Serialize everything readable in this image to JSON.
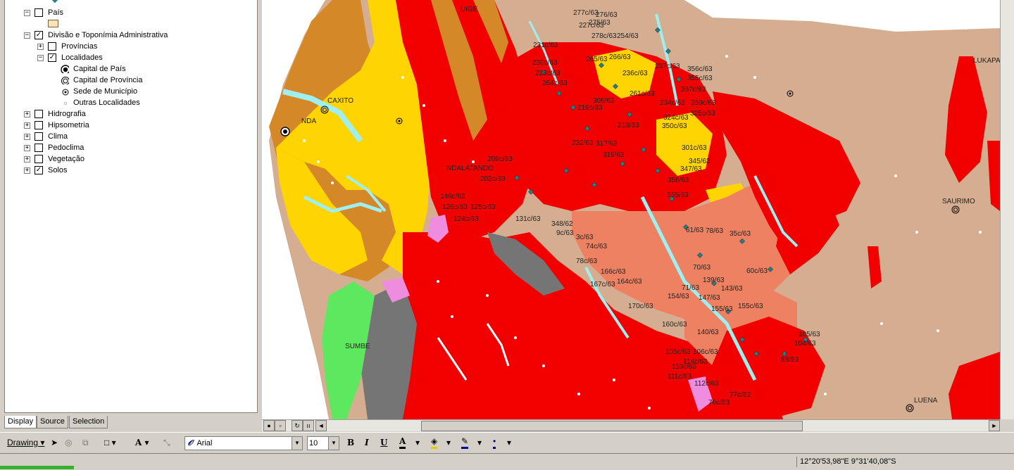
{
  "toc": {
    "layers": [
      {
        "label": "País",
        "expander": "−",
        "checked": false
      },
      {
        "label": "Divisão e Toponímia Administrativa",
        "expander": "−",
        "checked": true
      },
      {
        "label": "Províncias",
        "expander": "+",
        "checked": false
      },
      {
        "label": "Localidades",
        "expander": "−",
        "checked": true
      },
      {
        "label": "Hidrografia",
        "expander": "+",
        "checked": false
      },
      {
        "label": "Hipsometria",
        "expander": "+",
        "checked": false
      },
      {
        "label": "Clima",
        "expander": "+",
        "checked": false
      },
      {
        "label": "Pedoclima",
        "expander": "+",
        "checked": false
      },
      {
        "label": "Vegetação",
        "expander": "+",
        "checked": false
      },
      {
        "label": "Solos",
        "expander": "+",
        "checked": true
      }
    ],
    "legend": [
      {
        "label": "Capital de País",
        "icon": "capital-country-icon"
      },
      {
        "label": "Capital de Província",
        "icon": "capital-province-icon"
      },
      {
        "label": "Sede de Município",
        "icon": "municipality-seat-icon"
      },
      {
        "label": "Outras Localidades",
        "icon": "other-locality-icon"
      }
    ],
    "country_swatch_color": "#f7e3b5",
    "tabs": [
      "Display",
      "Source",
      "Selection"
    ],
    "active_tab": "Display"
  },
  "map": {
    "colors": {
      "background": "#d5ae92",
      "red": "#f20000",
      "yellow": "#ffd400",
      "orange": "#d48827",
      "salmon": "#ef8163",
      "cyan": "#9feef0",
      "green": "#5de85f",
      "gray": "#757575",
      "pink": "#f08ce0",
      "point": "#2a7d84"
    },
    "place_labels": [
      "UIGE",
      "CAXITO",
      "NDA",
      "NDALATANDO",
      "SUMBE",
      "LUENA",
      "SAURIMO",
      "LUKAPA"
    ],
    "parcel_labels": [
      "277c/63",
      "276/63",
      "275/63",
      "227c/63",
      "278c/63",
      "254/63",
      "231c/63",
      "230c/63",
      "265/63",
      "266/63",
      "228c/63",
      "264c/63",
      "236c/63",
      "237c/63",
      "261c/63",
      "219c/63",
      "306/63",
      "218/63",
      "232/63",
      "317/63",
      "319/63",
      "209c/63",
      "202c/63",
      "146c/63",
      "126c/63",
      "125c/63",
      "124c/63",
      "131c/63",
      "348/62",
      "9c/63",
      "3c/63",
      "74c/63",
      "78c/63",
      "166c/63",
      "167c/63",
      "164c/63",
      "170c/63",
      "154/63",
      "160c/63",
      "140/63",
      "105c/63",
      "106c/63",
      "114c/63",
      "110c/63",
      "111c/63",
      "112c/63",
      "76c/63",
      "77c/62",
      "88/63",
      "105/63",
      "104/63",
      "358/63",
      "365/63",
      "345/63",
      "347/63",
      "301c/63",
      "357c/63",
      "359c/63",
      "325c/63",
      "294c/63",
      "324c/63",
      "350c/63",
      "355c/63",
      "356c/63",
      "61/63",
      "78/63",
      "35c/63",
      "70/63",
      "60c/63",
      "139/63",
      "143/63",
      "147/63",
      "155/63",
      "71/63",
      "155c/63"
    ],
    "local_points_count": "many"
  },
  "map_controls": {
    "left_buttons": [
      "globe-icon",
      "page-icon",
      "refresh-icon",
      "pause-icon"
    ],
    "scroll_left": "◄",
    "scroll_right": "►"
  },
  "drawing_toolbar": {
    "drawing_label": "Drawing",
    "font_name": "Arial",
    "font_size": "10",
    "bold": "B",
    "italic": "I",
    "underline": "U",
    "text_tool": "A"
  },
  "status": {
    "coordinates": "12°20'53,98\"E  9°31'40,08\"S"
  }
}
